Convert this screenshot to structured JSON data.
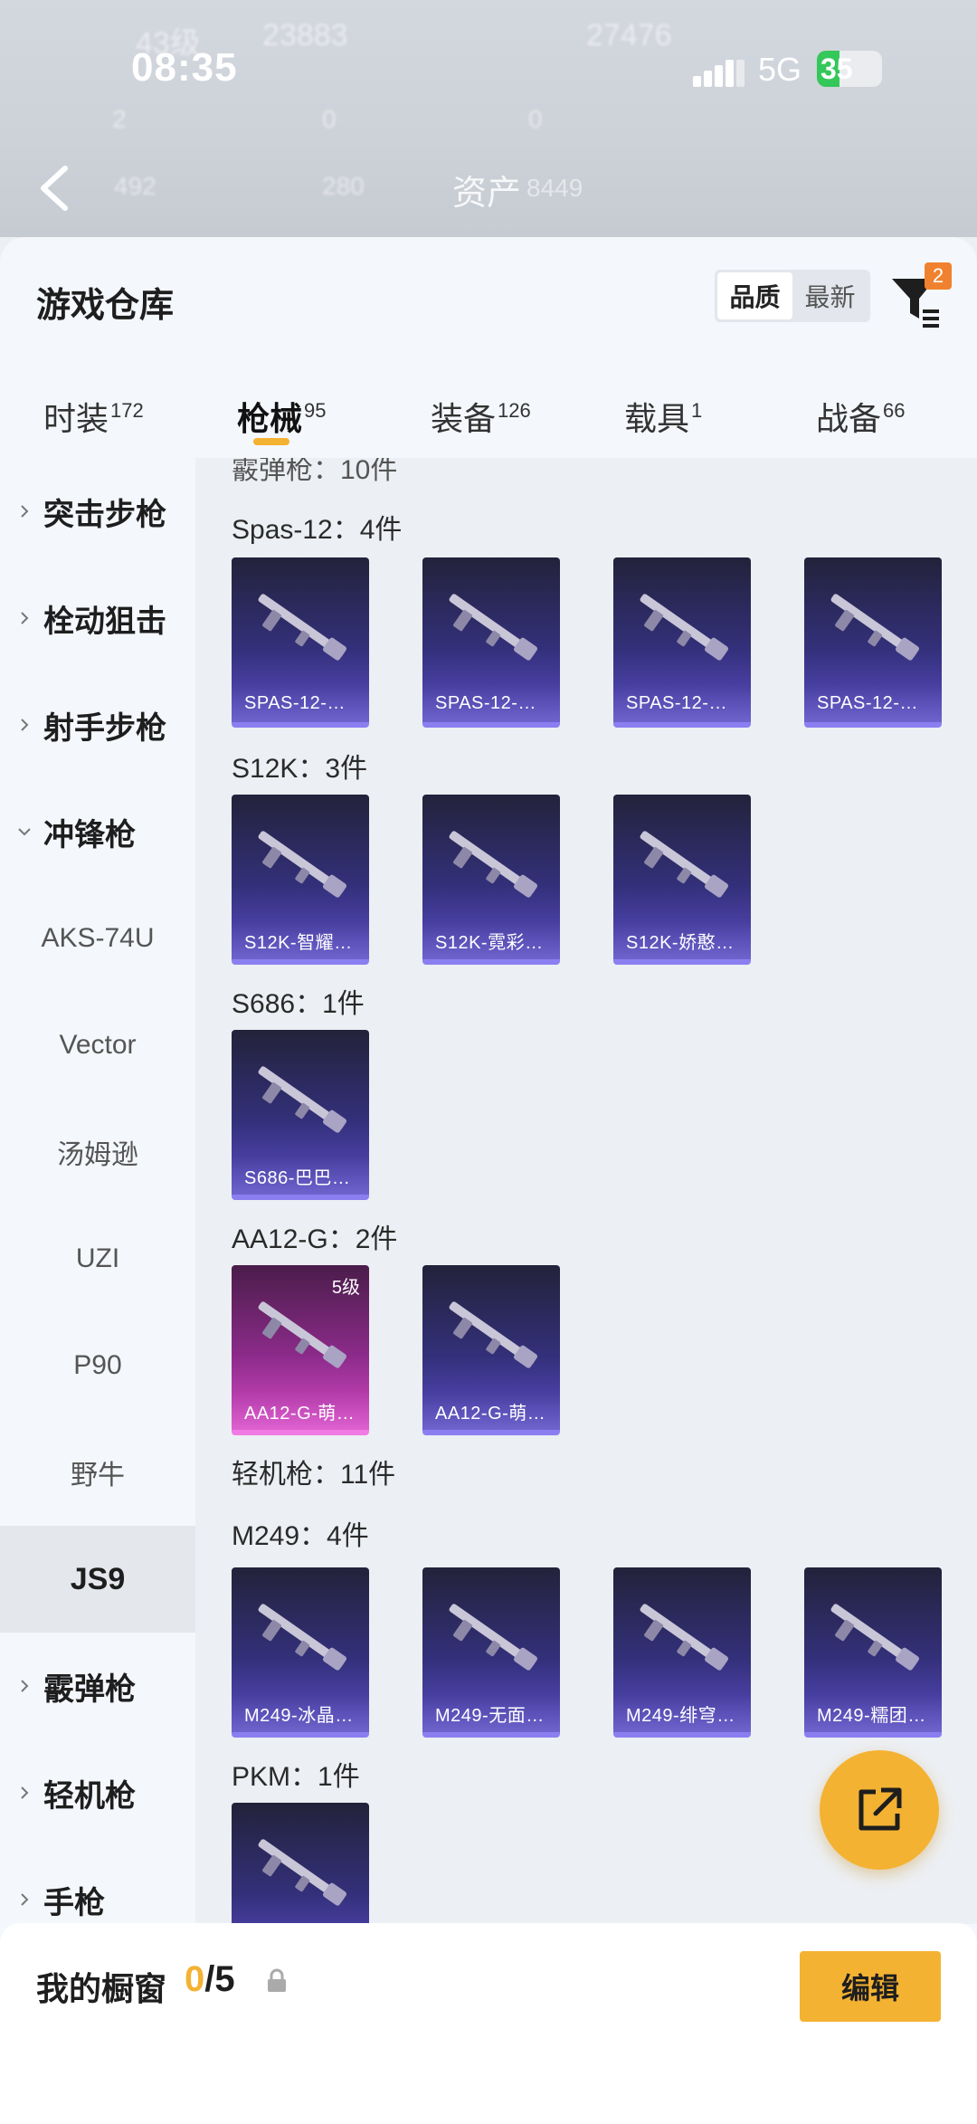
{
  "status_bar": {
    "time": "08:35",
    "network": "5G",
    "battery": "35",
    "battery_level": 0.35
  },
  "ghost_header": {
    "level": "43级",
    "stat_a": "23883",
    "stat_b": "27476",
    "count_a": "2",
    "count_b": "0",
    "count_c": "0",
    "bottom_a": "492",
    "bottom_b": "280",
    "assets_label": "资产",
    "assets_value": "8449"
  },
  "sheet": {
    "title": "游戏仓库",
    "sort": {
      "quality": "品质",
      "newest": "最新"
    },
    "filter_badge": "2"
  },
  "tabs": [
    {
      "label": "时装",
      "count": "172"
    },
    {
      "label": "枪械",
      "count": "95"
    },
    {
      "label": "装备",
      "count": "126"
    },
    {
      "label": "载具",
      "count": "1"
    },
    {
      "label": "战备",
      "count": "66"
    }
  ],
  "sidebar": {
    "categories": [
      "突击步枪",
      "栓动狙击",
      "射手步枪",
      "冲锋枪",
      "霰弹枪",
      "轻机枪",
      "手枪"
    ],
    "submachine_items": [
      "AKS-74U",
      "Vector",
      "汤姆逊",
      "UZI",
      "P90",
      "野牛",
      "JS9"
    ]
  },
  "content": {
    "shotgun_header": "霰弹枪：10件",
    "lmg_header": "轻机枪：11件",
    "groups": [
      {
        "title": "Spas-12：4件",
        "items": [
          "SPAS-12-…",
          "SPAS-12-…",
          "SPAS-12-…",
          "SPAS-12-…"
        ]
      },
      {
        "title": "S12K：3件",
        "items": [
          "S12K-智耀…",
          "S12K-霓彩…",
          "S12K-娇憨…"
        ]
      },
      {
        "title": "S686：1件",
        "items": [
          "S686-巴巴…"
        ]
      },
      {
        "title": "AA12-G：2件",
        "items": [
          "AA12-G-萌…",
          "AA12-G-萌…"
        ],
        "level": "5级"
      },
      {
        "title": "M249：4件",
        "items": [
          "M249-冰晶…",
          "M249-无面…",
          "M249-绯穹…",
          "M249-糯团…"
        ]
      },
      {
        "title": "PKM：1件",
        "items": [
          ""
        ]
      }
    ]
  },
  "bottom": {
    "title": "我的橱窗",
    "count_current": "0",
    "count_total": "/5",
    "edit": "编辑"
  }
}
